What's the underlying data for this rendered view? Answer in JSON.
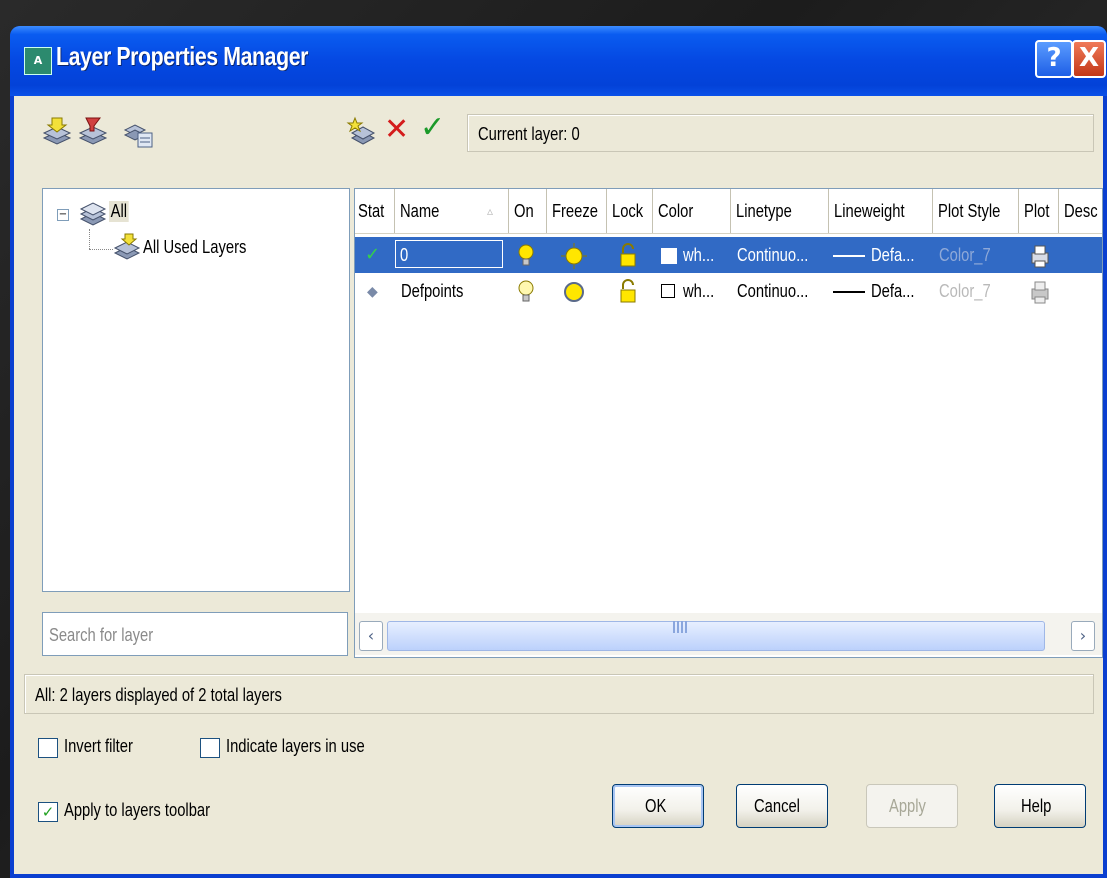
{
  "window": {
    "title": "Layer Properties Manager",
    "help_glyph": "?",
    "close_glyph": "X",
    "icon_text": "A"
  },
  "toolbar": {
    "left_icons": [
      "new-property-filter-icon",
      "new-group-filter-icon",
      "layer-states-manager-icon"
    ],
    "right_icons": [
      "new-layer-icon",
      "delete-layer-icon",
      "set-current-icon"
    ],
    "delete_glyph": "✕",
    "set_current_glyph": "✓",
    "current_layer_text": "Current layer: 0"
  },
  "tree": {
    "expander": "−",
    "root_label": "All",
    "child_label": "All Used Layers"
  },
  "search": {
    "placeholder": "Search for layer"
  },
  "grid": {
    "headers": {
      "status": "Stat",
      "name": "Name",
      "on": "On",
      "freeze": "Freeze",
      "lock": "Lock",
      "color": "Color",
      "linetype": "Linetype",
      "lineweight": "Lineweight",
      "plot_style": "Plot Style",
      "plot": "Plot",
      "description": "Desc"
    },
    "sort_glyph": "▵",
    "rows": [
      {
        "status_glyph": "✓",
        "name": "0",
        "color_swatch": "#ffffff",
        "color": "wh...",
        "linetype": "Continuo...",
        "lineweight": "Defa...",
        "plot_style": "Color_7"
      },
      {
        "status_glyph": "◆",
        "name": "Defpoints",
        "color_swatch": "#ffffff",
        "color": "wh...",
        "linetype": "Continuo...",
        "lineweight": "Defa...",
        "plot_style": "Color_7"
      }
    ],
    "scroll_left": "‹",
    "scroll_right": "›"
  },
  "status_text": "All: 2 layers displayed of 2 total layers",
  "options": {
    "invert_filter": {
      "label": "Invert filter",
      "checked": false
    },
    "indicate_in_use": {
      "label": "Indicate layers in use",
      "checked": false
    },
    "apply_toolbar": {
      "label": "Apply to layers toolbar",
      "checked": true,
      "glyph": "✓"
    }
  },
  "buttons": {
    "ok": "OK",
    "cancel": "Cancel",
    "apply": "Apply",
    "help": "Help"
  },
  "colors": {
    "selection": "#316ac5",
    "titlebar": "#0548e2",
    "dialog_bg": "#ece9d8"
  }
}
